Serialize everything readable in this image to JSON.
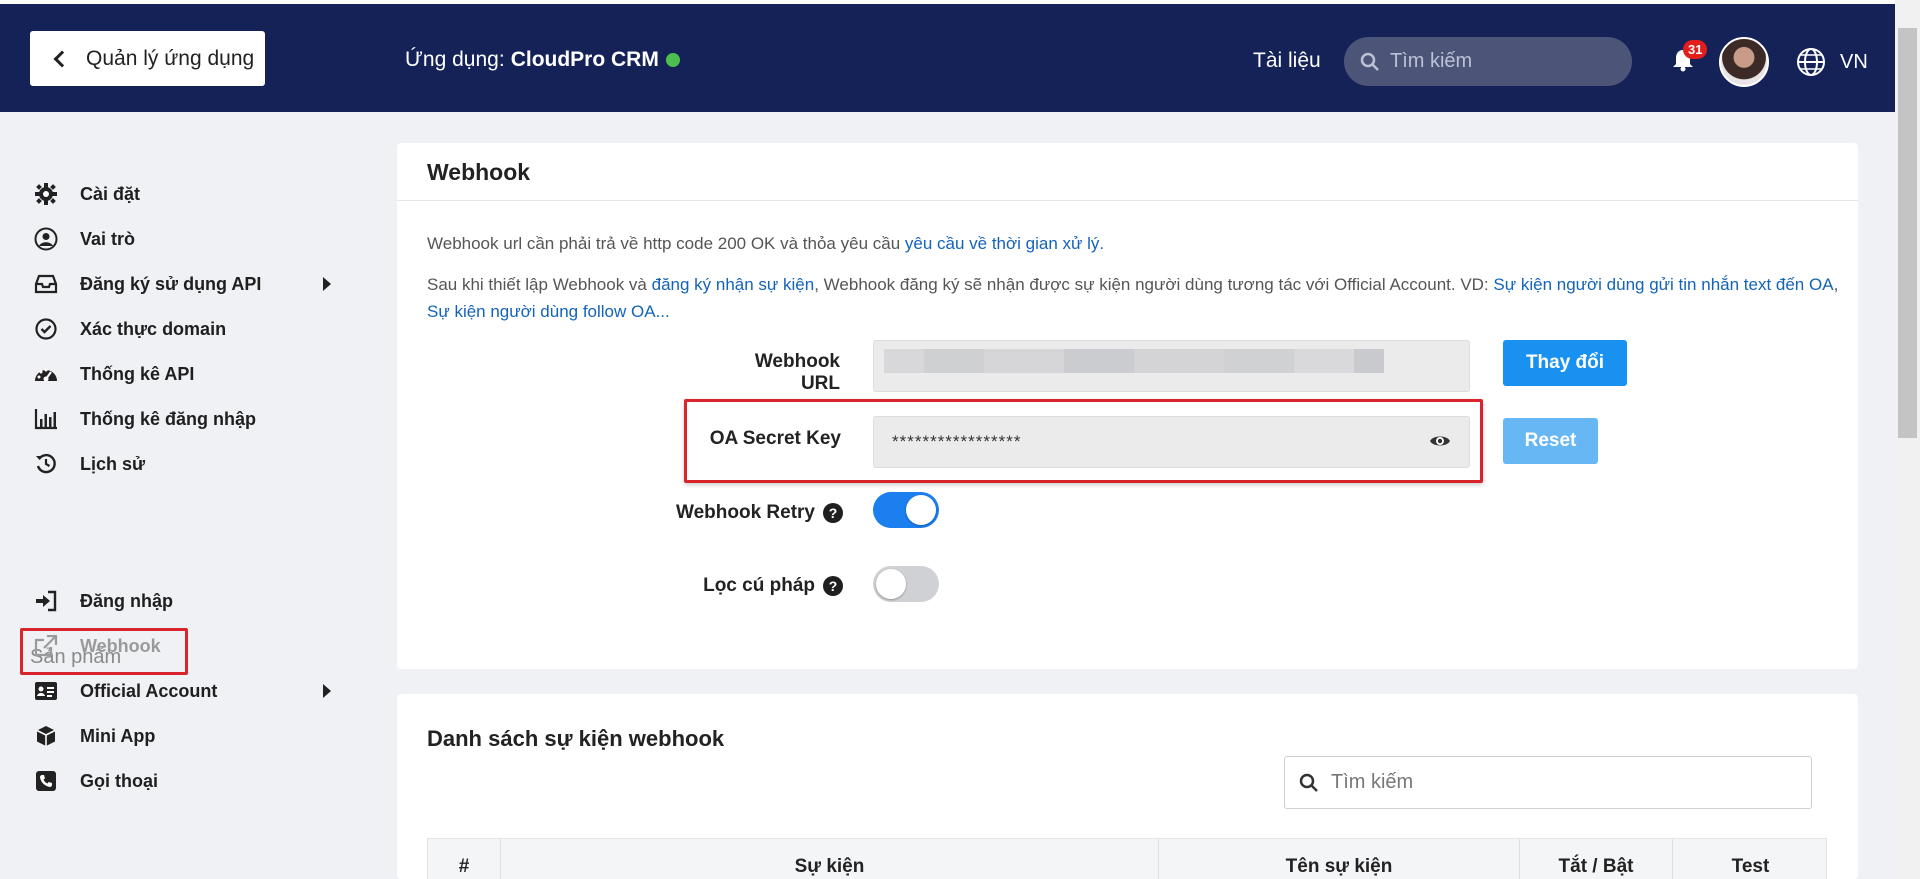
{
  "header": {
    "back_label": "Quản lý ứng dụng",
    "app_prefix": "Ứng dụng:",
    "app_name": "CloudPro CRM",
    "docs_label": "Tài liệu",
    "search_placeholder": "Tìm kiếm",
    "notification_count": "31",
    "language": "VN"
  },
  "sidebar": {
    "items": [
      {
        "label": "Cài đặt",
        "icon": "gear-icon"
      },
      {
        "label": "Vai trò",
        "icon": "user-circle-icon"
      },
      {
        "label": "Đăng ký sử dụng API",
        "icon": "inbox-icon"
      },
      {
        "label": "Xác thực domain",
        "icon": "check-circle-icon"
      },
      {
        "label": "Thống kê API",
        "icon": "gauge-icon"
      },
      {
        "label": "Thống kê đăng nhập",
        "icon": "bar-chart-icon"
      },
      {
        "label": "Lịch sử",
        "icon": "history-icon"
      }
    ],
    "section_label": "Sản phẩm",
    "product_items": [
      {
        "label": "Đăng nhập",
        "icon": "sign-in-icon"
      },
      {
        "label": "Webhook",
        "icon": "external-link-icon"
      },
      {
        "label": "Official Account",
        "icon": "id-card-icon"
      },
      {
        "label": "Mini App",
        "icon": "cube-icon"
      },
      {
        "label": "Gọi thoại",
        "icon": "phone-icon"
      }
    ]
  },
  "webhook": {
    "title": "Webhook",
    "desc1_text": "Webhook url cần phải trả về http code 200 OK và thỏa yêu cầu ",
    "desc1_link": "yêu cầu về thời gian xử lý.",
    "desc2_text_a": "Sau khi thiết lập Webhook và ",
    "desc2_link_a": "đăng ký nhận sự kiện",
    "desc2_text_b": ", Webhook đăng ký sẽ nhận được sự kiện người dùng tương tác với Official Account. VD: ",
    "desc2_link_b": "Sự kiện người dùng gửi tin nhắn text đến OA",
    "desc2_sep": ", ",
    "desc2_link_c": "Sự kiện người dùng follow OA...",
    "url_label": "Webhook URL",
    "change_button": "Thay đổi",
    "secret_label": "OA Secret Key",
    "secret_value": "*****************",
    "reset_button": "Reset",
    "retry_label": "Webhook Retry",
    "retry_enabled": true,
    "filter_label": "Lọc cú pháp",
    "filter_enabled": false
  },
  "events": {
    "title": "Danh sách sự kiện webhook",
    "search_placeholder": "Tìm kiếm",
    "columns": [
      "#",
      "Sự kiện",
      "Tên sự kiện",
      "Tắt / Bật",
      "Test"
    ]
  },
  "colors": {
    "header_bg": "#142258",
    "primary": "#1891f0",
    "highlight": "#d9232d",
    "status_online": "#4cbf4f"
  }
}
